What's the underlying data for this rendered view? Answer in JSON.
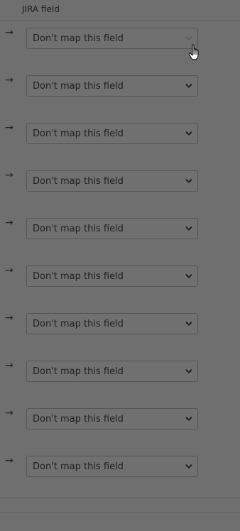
{
  "header": {
    "title": "JIRA field"
  },
  "rows": [
    {
      "arrow": "→",
      "select_value": "Don't map this field"
    },
    {
      "arrow": "→",
      "select_value": "Don't map this field"
    },
    {
      "arrow": "→",
      "select_value": "Don't map this field"
    },
    {
      "arrow": "→",
      "select_value": "Don't map this field"
    },
    {
      "arrow": "→",
      "select_value": "Don't map this field"
    },
    {
      "arrow": "→",
      "select_value": "Don't map this field"
    },
    {
      "arrow": "→",
      "select_value": "Don't map this field"
    },
    {
      "arrow": "→",
      "select_value": "Don't map this field"
    },
    {
      "arrow": "→",
      "select_value": "Don't map this field"
    },
    {
      "arrow": "→",
      "select_value": "Don't map this field"
    }
  ],
  "icons": {
    "arrow": "right-arrow-icon",
    "dropdown": "chevron-down-icon",
    "cursor": "hand-pointer-cursor-icon"
  },
  "colors": {
    "background": "#6f6f6f",
    "text": "#1f1f1f",
    "border": "#555555"
  }
}
